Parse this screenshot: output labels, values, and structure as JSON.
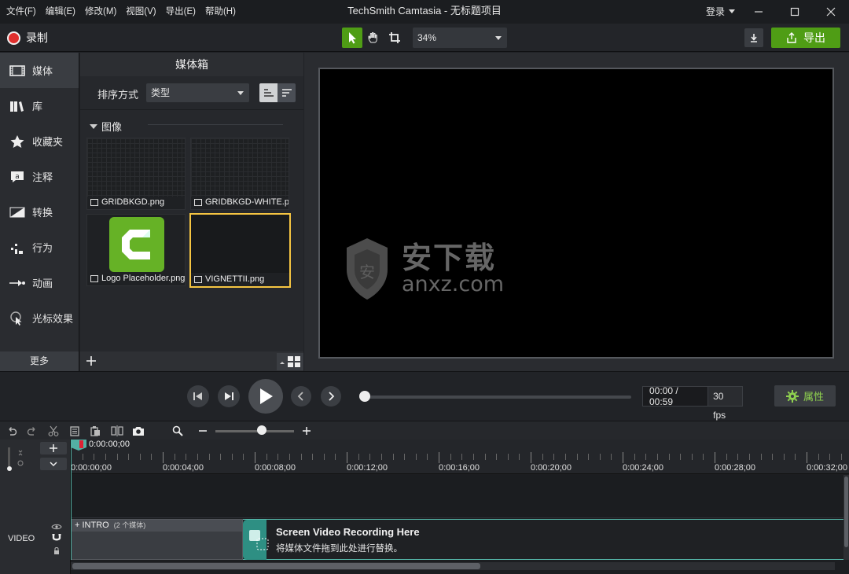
{
  "window": {
    "title": "TechSmith Camtasia - 无标题项目",
    "login": "登录"
  },
  "menu": [
    "文件(F)",
    "编辑(E)",
    "修改(M)",
    "视图(V)",
    "导出(E)",
    "帮助(H)"
  ],
  "toolbar": {
    "record_label": "录制",
    "zoom_value": "34%",
    "export_label": "导出"
  },
  "nav": {
    "items": [
      {
        "label": "媒体",
        "icon": "film-icon",
        "active": true
      },
      {
        "label": "库",
        "icon": "library-icon"
      },
      {
        "label": "收藏夹",
        "icon": "star-icon"
      },
      {
        "label": "注释",
        "icon": "annotation-icon"
      },
      {
        "label": "转换",
        "icon": "transition-icon"
      },
      {
        "label": "行为",
        "icon": "behavior-icon"
      },
      {
        "label": "动画",
        "icon": "animation-icon"
      },
      {
        "label": "光标效果",
        "icon": "cursor-effect-icon"
      }
    ],
    "more_label": "更多"
  },
  "bin": {
    "title": "媒体箱",
    "sort_label": "排序方式",
    "sort_value": "类型",
    "group_label": "图像",
    "items": [
      {
        "name": "GRIDBKGD.png"
      },
      {
        "name": "GRIDBKGD-WHITE.png"
      },
      {
        "name": "Logo Placeholder.png"
      },
      {
        "name": "VIGNETTII.png",
        "selected": true
      }
    ]
  },
  "watermark": {
    "cn": "安下载",
    "en": "anxz.com"
  },
  "playback": {
    "time": "00:00 / 00:59",
    "fps": "30 fps",
    "properties_label": "属性"
  },
  "timeline": {
    "playhead_time": "0:00:00;00",
    "ruler_labels": [
      "0:00:00;00",
      "0:00:04;00",
      "0:00:08;00",
      "0:00:12;00",
      "0:00:16;00",
      "0:00:20;00",
      "0:00:24;00",
      "0:00:28;00",
      "0:00:32;00"
    ],
    "track_label": "VIDEO",
    "intro_label": "INTRO",
    "intro_count": "(2 个媒体)",
    "placeholder_title": "Screen Video Recording Here",
    "placeholder_sub": "将媒体文件拖到此处进行替换。"
  },
  "colors": {
    "accent": "#4f9d15",
    "record": "#e0302e",
    "track_accent": "#2e8f83",
    "selection": "#f5c542"
  }
}
